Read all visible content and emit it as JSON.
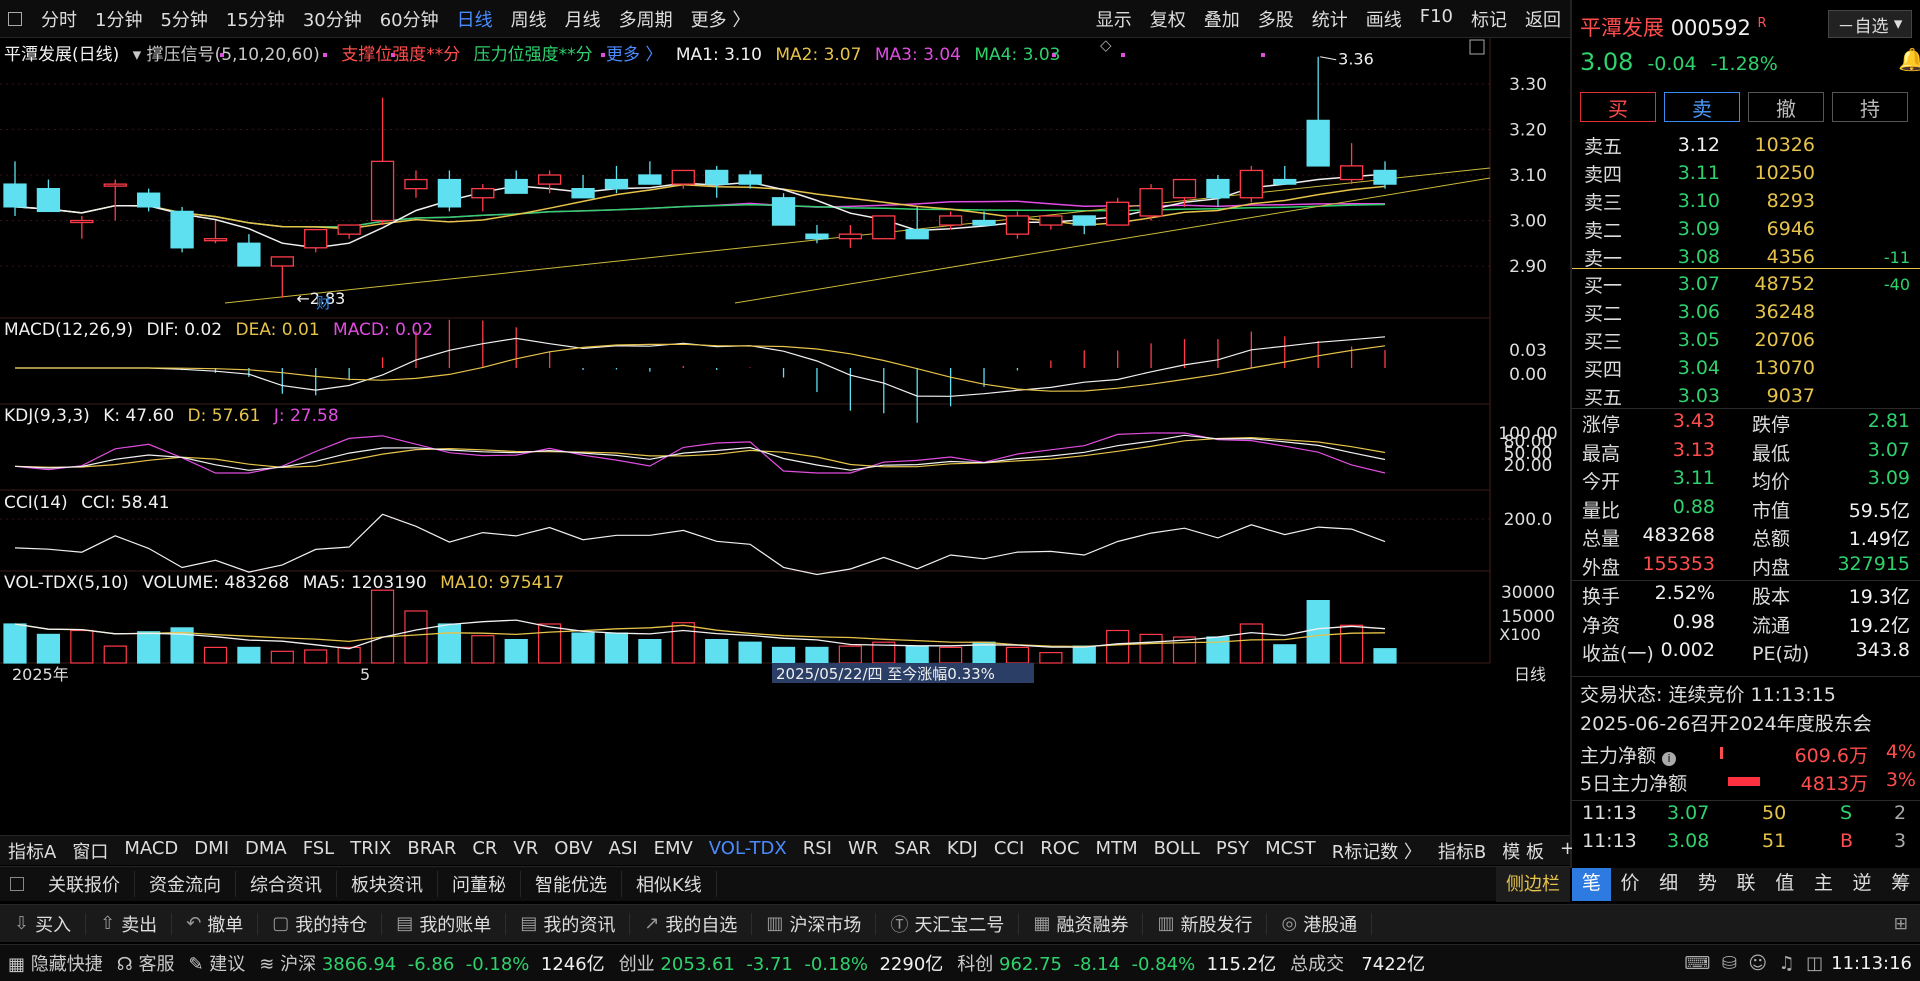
{
  "toolbar": {
    "period_tabs": [
      "分时",
      "1分钟",
      "5分钟",
      "15分钟",
      "30分钟",
      "60分钟",
      "日线",
      "周线",
      "月线",
      "多周期",
      "更多 〉"
    ],
    "active_period": "日线",
    "right_tabs": [
      "显示",
      "复权",
      "叠加",
      "多股",
      "统计",
      "画线",
      "F10",
      "标记",
      "返回"
    ]
  },
  "main_header": {
    "name": "平潭发展(日线)",
    "indicator": "撑压信号(5,10,20,60)",
    "support": "支撑位强度**分",
    "pressure": "压力位强度**分",
    "more": "更多 〉",
    "ma1": "MA1: 3.10",
    "ma2": "MA2: 3.07",
    "ma3": "MA3: 3.04",
    "ma4": "MA4: 3.03"
  },
  "price_axis": [
    "3.30",
    "3.20",
    "3.10",
    "3.00",
    "2.90"
  ],
  "annotations": {
    "high": "3.36",
    "low": "2.83",
    "fin": "财",
    "year": "2025年",
    "month": "5",
    "date_tip": "2025/05/22/四  至今涨幅0.33%",
    "x100": "X100",
    "period_label": "日线"
  },
  "macd": {
    "label": "MACD(12,26,9)",
    "dif": "DIF: 0.02",
    "dea": "DEA: 0.01",
    "macd": "MACD: 0.02",
    "axis": [
      "0.03",
      "0.00"
    ]
  },
  "kdj": {
    "label": "KDJ(9,3,3)",
    "k": "K: 47.60",
    "d": "D: 57.61",
    "j": "J: 27.58",
    "axis": [
      "100.00",
      "80.00",
      "50.00",
      "20.00"
    ]
  },
  "cci": {
    "label": "CCI(14)",
    "cci": "CCI: 58.41",
    "axis": [
      "200.0"
    ]
  },
  "vol": {
    "label": "VOL-TDX(5,10)",
    "volume": "VOLUME: 483268",
    "ma5": "MA5: 1203190",
    "ma10": "MA10: 975417",
    "axis": [
      "30000",
      "15000"
    ]
  },
  "indicator_tabs": [
    "指标A",
    "窗口",
    "MACD",
    "DMI",
    "DMA",
    "FSL",
    "TRIX",
    "BRAR",
    "CR",
    "VR",
    "OBV",
    "ASI",
    "EMV",
    "VOL-TDX",
    "RSI",
    "WR",
    "SAR",
    "KDJ",
    "CCI",
    "ROC",
    "MTM",
    "BOLL",
    "PSY",
    "MCST",
    "R标记数 〉"
  ],
  "active_indicator": "VOL-TDX",
  "indicator_right": [
    "指标B",
    "模 板",
    "+",
    "−"
  ],
  "info_tabs": [
    "关联报价",
    "资金流向",
    "综合资讯",
    "板块资讯",
    "问董秘",
    "智能优选",
    "相似K线"
  ],
  "side_btn": "侧边栏",
  "right_tabs5": [
    "笔",
    "价",
    "细",
    "势",
    "联",
    "值",
    "主",
    "逆",
    "筹"
  ],
  "trade_toolbar": [
    {
      "icon": "⇩",
      "label": "买入"
    },
    {
      "icon": "⇧",
      "label": "卖出"
    },
    {
      "icon": "↶",
      "label": "撤单"
    },
    {
      "icon": "▢",
      "label": "我的持仓"
    },
    {
      "icon": "▤",
      "label": "我的账单"
    },
    {
      "icon": "▤",
      "label": "我的资讯"
    },
    {
      "icon": "↗",
      "label": "我的自选"
    },
    {
      "icon": "▥",
      "label": "沪深市场"
    },
    {
      "icon": "Ⓣ",
      "label": "天汇宝二号"
    },
    {
      "icon": "▦",
      "label": "融资融券"
    },
    {
      "icon": "▥",
      "label": "新股发行"
    },
    {
      "icon": "◎",
      "label": "港股通"
    }
  ],
  "status_bar": {
    "hide": "隐藏快捷",
    "service": "客服",
    "suggest": "建议",
    "sh_name": "沪深",
    "sh_val": "3866.94",
    "sh_chg": "-6.86",
    "sh_pct": "-0.18%",
    "sh_amt": "1246亿",
    "cy_name": "创业",
    "cy_val": "2053.61",
    "cy_chg": "-3.71",
    "cy_pct": "-0.18%",
    "cy_amt": "2290亿",
    "kc_name": "科创",
    "kc_val": "962.75",
    "kc_chg": "-8.14",
    "kc_pct": "-0.84%",
    "kc_amt": "115.2亿",
    "total_name": "总成交",
    "total_amt": "7422亿",
    "time": "11:13:16"
  },
  "stock": {
    "name": "平潭发展",
    "code": "000592",
    "flag": "R",
    "watch": "－自选",
    "price": "3.08",
    "change": "-0.04",
    "pct": "-1.28%",
    "buttons": [
      "买",
      "卖",
      "撤",
      "持"
    ]
  },
  "orderbook_sell": [
    {
      "label": "卖五",
      "price": "3.12",
      "vol": "10326",
      "diff": ""
    },
    {
      "label": "卖四",
      "price": "3.11",
      "vol": "10250",
      "diff": ""
    },
    {
      "label": "卖三",
      "price": "3.10",
      "vol": "8293",
      "diff": ""
    },
    {
      "label": "卖二",
      "price": "3.09",
      "vol": "6946",
      "diff": ""
    },
    {
      "label": "卖一",
      "price": "3.08",
      "vol": "4356",
      "diff": "-11"
    }
  ],
  "orderbook_buy": [
    {
      "label": "买一",
      "price": "3.07",
      "vol": "48752",
      "diff": "-40"
    },
    {
      "label": "买二",
      "price": "3.06",
      "vol": "36248",
      "diff": ""
    },
    {
      "label": "买三",
      "price": "3.05",
      "vol": "20706",
      "diff": ""
    },
    {
      "label": "买四",
      "price": "3.04",
      "vol": "13070",
      "diff": ""
    },
    {
      "label": "买五",
      "price": "3.03",
      "vol": "9037",
      "diff": ""
    }
  ],
  "stats": [
    {
      "l1": "涨停",
      "v1": "3.43",
      "c1": "red",
      "l2": "跌停",
      "v2": "2.81",
      "c2": "green"
    },
    {
      "l1": "最高",
      "v1": "3.13",
      "c1": "red",
      "l2": "最低",
      "v2": "3.07",
      "c2": "green"
    },
    {
      "l1": "今开",
      "v1": "3.11",
      "c1": "green",
      "l2": "均价",
      "v2": "3.09",
      "c2": "green"
    },
    {
      "l1": "量比",
      "v1": "0.88",
      "c1": "green",
      "l2": "市值",
      "v2": "59.5亿",
      "c2": "wht"
    },
    {
      "l1": "总量",
      "v1": "483268",
      "c1": "wht",
      "l2": "总额",
      "v2": "1.49亿",
      "c2": "wht"
    },
    {
      "l1": "外盘",
      "v1": "155353",
      "c1": "red",
      "l2": "内盘",
      "v2": "327915",
      "c2": "green"
    }
  ],
  "stats2": [
    {
      "l1": "换手",
      "v1": "2.52%",
      "l2": "股本",
      "v2": "19.3亿"
    },
    {
      "l1": "净资",
      "v1": "0.98",
      "l2": "流通",
      "v2": "19.2亿"
    },
    {
      "l1": "收益(一)",
      "v1": "0.002",
      "l2": "PE(动)",
      "v2": "343.8"
    }
  ],
  "trade_info": {
    "status": "交易状态: 连续竞价 11:13:15",
    "notice": "2025-06-26召开2024年度股东会",
    "main_net_label": "主力净额",
    "main_net_val": "609.6万",
    "main_net_pct": "4%",
    "five_net_label": "5日主力净额",
    "five_net_val": "4813万",
    "five_net_pct": "3%"
  },
  "ticks": [
    {
      "time": "11:13",
      "price": "3.07",
      "vol": "50",
      "side": "S",
      "n": "2"
    },
    {
      "time": "11:13",
      "price": "3.08",
      "vol": "51",
      "side": "B",
      "n": "3"
    }
  ],
  "chart_data": {
    "type": "candlestick",
    "candles": [
      {
        "o": 3.08,
        "h": 3.13,
        "l": 3.01,
        "c": 3.03
      },
      {
        "o": 3.07,
        "h": 3.09,
        "l": 3.02,
        "c": 3.02
      },
      {
        "o": 3.0,
        "h": 3.01,
        "l": 2.96,
        "c": 3.0
      },
      {
        "o": 3.08,
        "h": 3.09,
        "l": 3.0,
        "c": 3.08
      },
      {
        "o": 3.06,
        "h": 3.07,
        "l": 3.02,
        "c": 3.03
      },
      {
        "o": 3.02,
        "h": 3.03,
        "l": 2.93,
        "c": 2.94
      },
      {
        "o": 2.96,
        "h": 3.0,
        "l": 2.95,
        "c": 2.96
      },
      {
        "o": 2.95,
        "h": 2.97,
        "l": 2.9,
        "c": 2.9
      },
      {
        "o": 2.9,
        "h": 2.92,
        "l": 2.83,
        "c": 2.92
      },
      {
        "o": 2.94,
        "h": 2.98,
        "l": 2.93,
        "c": 2.98
      },
      {
        "o": 2.97,
        "h": 2.99,
        "l": 2.96,
        "c": 2.99
      },
      {
        "o": 3.0,
        "h": 3.27,
        "l": 2.99,
        "c": 3.13
      },
      {
        "o": 3.07,
        "h": 3.11,
        "l": 3.05,
        "c": 3.09
      },
      {
        "o": 3.09,
        "h": 3.11,
        "l": 3.02,
        "c": 3.03
      },
      {
        "o": 3.05,
        "h": 3.08,
        "l": 3.02,
        "c": 3.07
      },
      {
        "o": 3.09,
        "h": 3.11,
        "l": 3.06,
        "c": 3.06
      },
      {
        "o": 3.08,
        "h": 3.11,
        "l": 3.06,
        "c": 3.1
      },
      {
        "o": 3.07,
        "h": 3.1,
        "l": 3.05,
        "c": 3.05
      },
      {
        "o": 3.09,
        "h": 3.12,
        "l": 3.06,
        "c": 3.07
      },
      {
        "o": 3.1,
        "h": 3.13,
        "l": 3.08,
        "c": 3.08
      },
      {
        "o": 3.08,
        "h": 3.11,
        "l": 3.07,
        "c": 3.11
      },
      {
        "o": 3.11,
        "h": 3.12,
        "l": 3.05,
        "c": 3.08
      },
      {
        "o": 3.1,
        "h": 3.11,
        "l": 3.07,
        "c": 3.08
      },
      {
        "o": 3.05,
        "h": 3.06,
        "l": 2.99,
        "c": 2.99
      },
      {
        "o": 2.97,
        "h": 2.99,
        "l": 2.95,
        "c": 2.96
      },
      {
        "o": 2.96,
        "h": 2.99,
        "l": 2.94,
        "c": 2.97
      },
      {
        "o": 2.96,
        "h": 3.01,
        "l": 2.96,
        "c": 3.01
      },
      {
        "o": 2.98,
        "h": 3.03,
        "l": 2.96,
        "c": 2.96
      },
      {
        "o": 2.99,
        "h": 3.02,
        "l": 2.98,
        "c": 3.01
      },
      {
        "o": 3.0,
        "h": 3.02,
        "l": 2.99,
        "c": 2.99
      },
      {
        "o": 2.97,
        "h": 3.02,
        "l": 2.96,
        "c": 3.01
      },
      {
        "o": 2.99,
        "h": 3.01,
        "l": 2.98,
        "c": 3.01
      },
      {
        "o": 3.01,
        "h": 3.01,
        "l": 2.97,
        "c": 2.99
      },
      {
        "o": 2.99,
        "h": 3.05,
        "l": 2.99,
        "c": 3.04
      },
      {
        "o": 3.01,
        "h": 3.08,
        "l": 3.0,
        "c": 3.07
      },
      {
        "o": 3.05,
        "h": 3.09,
        "l": 3.03,
        "c": 3.09
      },
      {
        "o": 3.09,
        "h": 3.1,
        "l": 3.03,
        "c": 3.05
      },
      {
        "o": 3.05,
        "h": 3.12,
        "l": 3.04,
        "c": 3.11
      },
      {
        "o": 3.09,
        "h": 3.12,
        "l": 3.08,
        "c": 3.08
      },
      {
        "o": 3.22,
        "h": 3.36,
        "l": 3.12,
        "c": 3.12
      },
      {
        "o": 3.09,
        "h": 3.17,
        "l": 3.08,
        "c": 3.12
      },
      {
        "o": 3.11,
        "h": 3.13,
        "l": 3.07,
        "c": 3.08
      }
    ],
    "volumes": [
      15000,
      11000,
      12500,
      6500,
      12000,
      13500,
      6000,
      6000,
      4500,
      5000,
      6000,
      28000,
      20000,
      15000,
      10500,
      9000,
      15000,
      11500,
      11500,
      9000,
      15500,
      9000,
      8000,
      6000,
      6000,
      6500,
      8000,
      6500,
      6000,
      8000,
      6000,
      4000,
      6500,
      12500,
      11000,
      10000,
      10000,
      15000,
      7000,
      24000,
      14500,
      5500
    ]
  }
}
